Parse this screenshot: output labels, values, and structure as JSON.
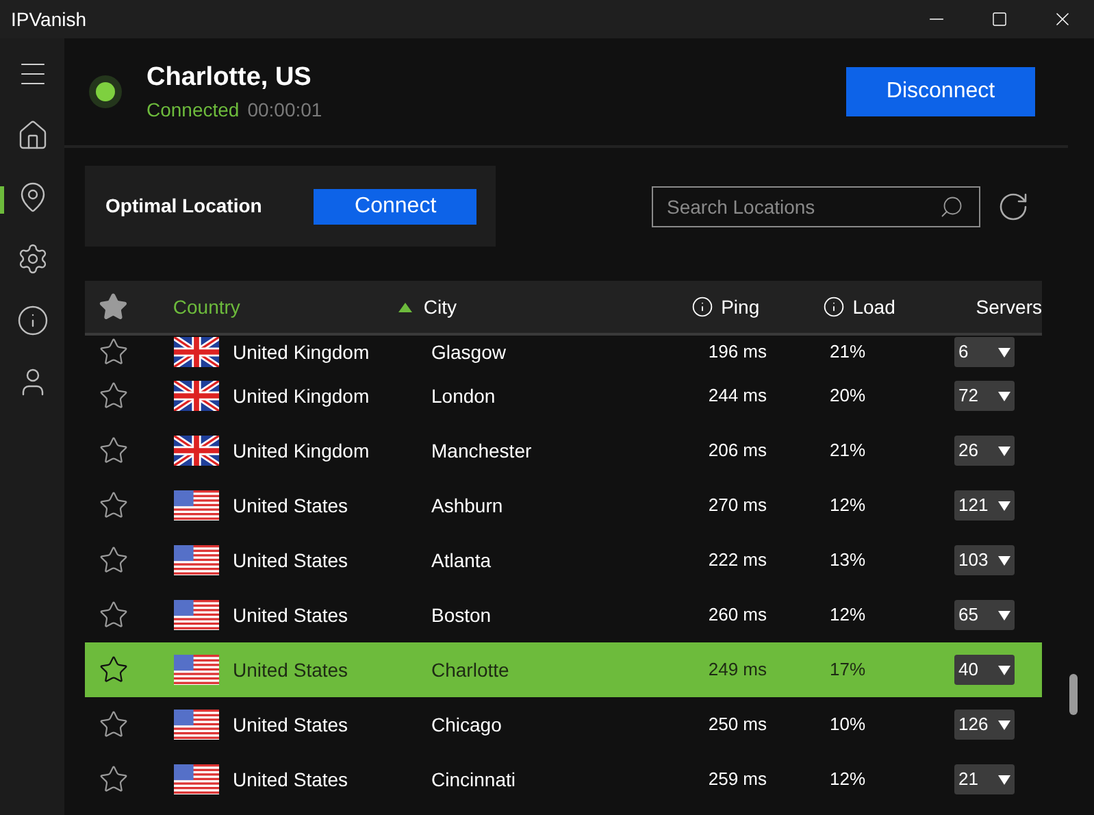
{
  "window": {
    "title": "IPVanish"
  },
  "sidebar": {
    "items": [
      {
        "kind": "home",
        "selected": false
      },
      {
        "kind": "location",
        "selected": true
      },
      {
        "kind": "settings",
        "selected": false
      },
      {
        "kind": "info",
        "selected": false
      },
      {
        "kind": "account",
        "selected": false
      }
    ]
  },
  "connection": {
    "location": "Charlotte, US",
    "status": "Connected",
    "time": "00:00:01",
    "connected": true,
    "button": "Disconnect"
  },
  "optimal": {
    "label": "Optimal Location",
    "button": "Connect"
  },
  "search": {
    "placeholder": "Search Locations"
  },
  "table": {
    "columns": [
      {
        "label": "Country",
        "sorted": true,
        "info": false
      },
      {
        "label": "City",
        "sorted": false,
        "info": false
      },
      {
        "label": "Ping",
        "sorted": false,
        "info": true
      },
      {
        "label": "Load",
        "sorted": false,
        "info": true
      },
      {
        "label": "Servers",
        "sorted": false,
        "info": false
      }
    ],
    "rows": [
      {
        "kind": "uk",
        "country": "United Kingdom",
        "city": "Glasgow",
        "ping": "196 ms",
        "load": "21%",
        "servers": "6",
        "favorite": false,
        "selected": false
      },
      {
        "kind": "uk",
        "country": "United Kingdom",
        "city": "London",
        "ping": "244 ms",
        "load": "20%",
        "servers": "72",
        "favorite": false,
        "selected": false
      },
      {
        "kind": "uk",
        "country": "United Kingdom",
        "city": "Manchester",
        "ping": "206 ms",
        "load": "21%",
        "servers": "26",
        "favorite": false,
        "selected": false
      },
      {
        "kind": "us",
        "country": "United States",
        "city": "Ashburn",
        "ping": "270 ms",
        "load": "12%",
        "servers": "121",
        "favorite": false,
        "selected": false
      },
      {
        "kind": "us",
        "country": "United States",
        "city": "Atlanta",
        "ping": "222 ms",
        "load": "13%",
        "servers": "103",
        "favorite": false,
        "selected": false
      },
      {
        "kind": "us",
        "country": "United States",
        "city": "Boston",
        "ping": "260 ms",
        "load": "12%",
        "servers": "65",
        "favorite": false,
        "selected": false
      },
      {
        "kind": "us",
        "country": "United States",
        "city": "Charlotte",
        "ping": "249 ms",
        "load": "17%",
        "servers": "40",
        "favorite": false,
        "selected": true
      },
      {
        "kind": "us",
        "country": "United States",
        "city": "Chicago",
        "ping": "250 ms",
        "load": "10%",
        "servers": "126",
        "favorite": false,
        "selected": false
      },
      {
        "kind": "us",
        "country": "United States",
        "city": "Cincinnati",
        "ping": "259 ms",
        "load": "12%",
        "servers": "21",
        "favorite": false,
        "selected": false
      }
    ]
  }
}
